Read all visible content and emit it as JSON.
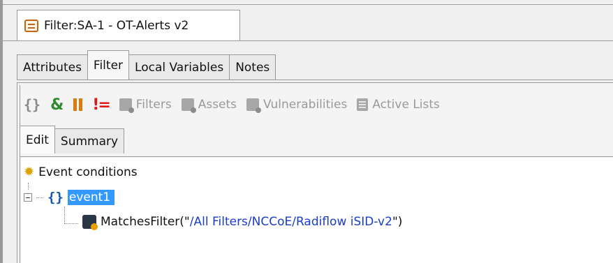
{
  "window": {
    "tab_title": "Filter:SA-1 - OT-Alerts v2",
    "tab_icon": "filter-document-icon"
  },
  "main_tabs": [
    {
      "label": "Attributes",
      "active": false
    },
    {
      "label": "Filter",
      "active": true
    },
    {
      "label": "Local Variables",
      "active": false
    },
    {
      "label": "Notes",
      "active": false
    }
  ],
  "toolbar": {
    "icons": [
      "and-braces-icon",
      "and-icon",
      "or-icon",
      "not-icon"
    ],
    "items": [
      {
        "label": "Filters",
        "icon": "filters-icon"
      },
      {
        "label": "Assets",
        "icon": "assets-icon"
      },
      {
        "label": "Vulnerabilities",
        "icon": "vulnerabilities-icon"
      },
      {
        "label": "Active Lists",
        "icon": "active-lists-icon"
      }
    ]
  },
  "sub_tabs": [
    {
      "label": "Edit",
      "active": true
    },
    {
      "label": "Summary",
      "active": false
    }
  ],
  "tree": {
    "root_label": "Event conditions",
    "node_label": "event1",
    "condition_prefix": "MatchesFilter(\"",
    "condition_path": "/All Filters/NCCoE/Radiflow iSID-v2",
    "condition_suffix": "\")"
  },
  "colors": {
    "selection": "#3399ff",
    "link_text": "#1a3cc8",
    "and_green": "#2e8b2e",
    "or_orange": "#e07a10",
    "not_red": "#e01818"
  }
}
